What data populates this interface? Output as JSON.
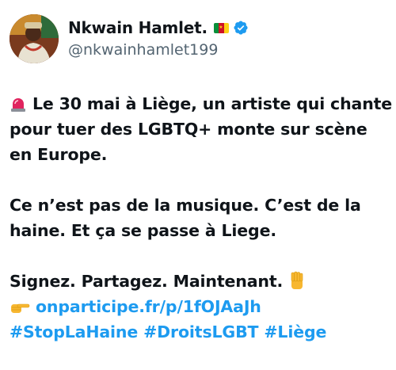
{
  "author": {
    "display_name": "Nkwain Hamlet.",
    "handle": "@nkwainhamlet199",
    "flag_icon": "cameroon-flag-icon",
    "verified_icon": "verified-badge-icon"
  },
  "tweet": {
    "line1": "Le 30 mai à Liège, un artiste qui chante",
    "line2": "pour tuer des LGBTQ+ monte sur scène",
    "line3": "en Europe.",
    "line4": "Ce n’est pas de la musique. C’est de la",
    "line5": "haine. Et ça se passe à Liege.",
    "line6": "Signez. Partagez. Maintenant.",
    "link": "onparticipe.fr/p/1fOJAaJh",
    "hashtags": [
      "#StopLaHaine",
      "#DroitsLGBT",
      "#Liège"
    ]
  },
  "colors": {
    "link": "#1d9bf0",
    "handle": "#536471",
    "text": "#0f1419"
  }
}
